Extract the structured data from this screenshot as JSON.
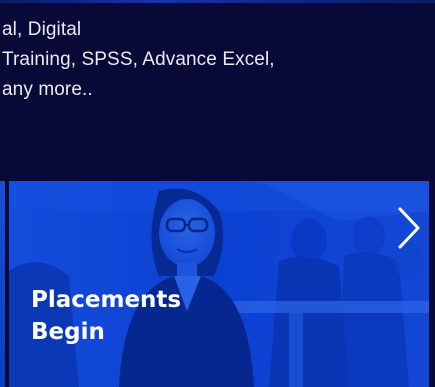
{
  "info": {
    "lines": [
      "al, Digital",
      "Training, SPSS, Advance Excel,",
      "any more.."
    ]
  },
  "slide": {
    "title_lines": [
      "Placements",
      "Begin"
    ]
  },
  "controls": {
    "next_icon": "chevron-right-icon"
  },
  "colors": {
    "panel_bg": "#090937",
    "slide_blue": "#0b3fd0",
    "text_light": "#e8eaf4"
  }
}
